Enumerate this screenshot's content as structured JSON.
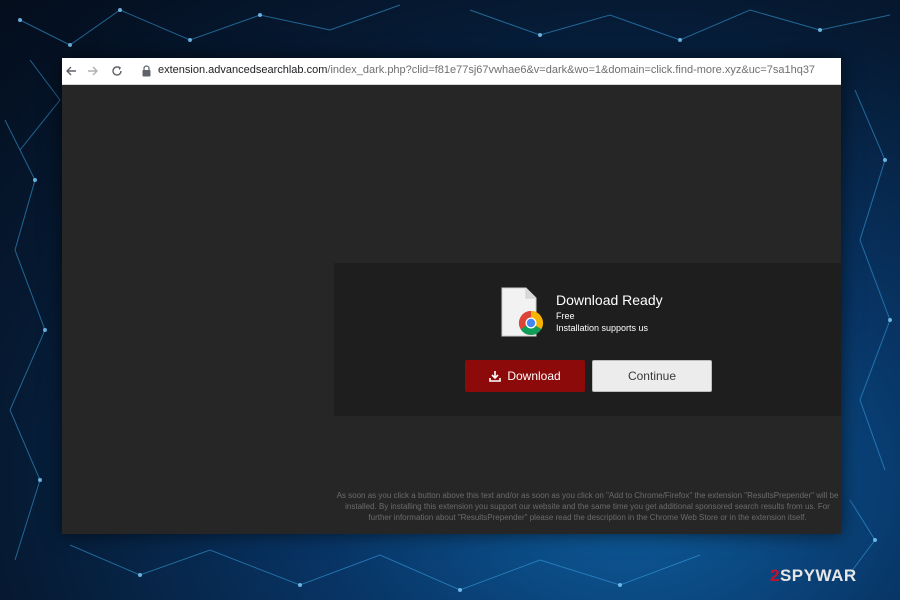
{
  "browser": {
    "url_host": "extension.advancedsearchlab.com",
    "url_path": "/index_dark.php?clid=f81e77sj67vwhae6&v=dark&wo=1&domain=click.find-more.xyz&uc=7sa1hq37",
    "back_icon": "arrow-left-icon",
    "forward_icon": "arrow-right-icon",
    "reload_icon": "reload-icon",
    "lock_icon": "lock-icon"
  },
  "download_box": {
    "title": "Download Ready",
    "subtitle_free": "Free",
    "subtitle_support": "Installation supports us",
    "file_icon": "chrome-file-icon",
    "download_label": "Download",
    "download_icon": "download-icon",
    "continue_label": "Continue",
    "download_color": "#8c0a0a",
    "continue_color": "#ececec"
  },
  "disclaimer": "As soon as you click a button above this text and/or as soon as you click on \"Add to Chrome/Firefox\" the extension \"ResultsPrepender\" will be installed. By installing this extension you support our website and the same time you get additional sponsored search results from us. For further information about \"ResultsPrepender\" please read the description in the Chrome Web Store or in the extension itself.",
  "watermark": {
    "prefix": "2",
    "word": "SPYWAR"
  }
}
